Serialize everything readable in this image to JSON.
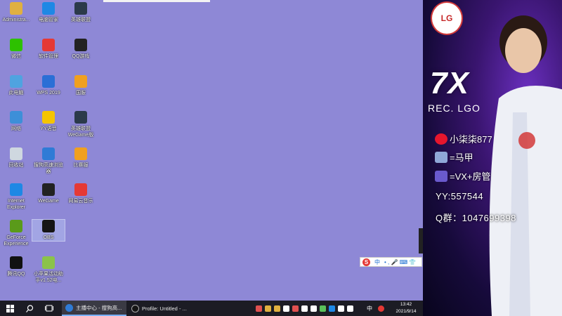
{
  "desktop": {
    "background_color": "#8e88d6",
    "icons": [
      {
        "label": "Administra...",
        "icon": "folder-user-icon",
        "color": "#e0b040"
      },
      {
        "label": "电脑管家",
        "icon": "shield-icon",
        "color": "#1e88e5"
      },
      {
        "label": "英雄联盟",
        "icon": "lol-icon",
        "color": "#2b3a4a"
      },
      {
        "label": "微信",
        "icon": "wechat-icon",
        "color": "#2dc100"
      },
      {
        "label": "软件管理",
        "icon": "apps-icon",
        "color": "#e53935"
      },
      {
        "label": "QQ游戏",
        "icon": "qq-game-icon",
        "color": "#222222"
      },
      {
        "label": "此电脑",
        "icon": "computer-icon",
        "color": "#4fa3e0"
      },
      {
        "label": "WPS 2019",
        "icon": "wps-icon",
        "color": "#2a6fd6"
      },
      {
        "label": "国服",
        "icon": "game-f-icon",
        "color": "#f0a020"
      },
      {
        "label": "网络",
        "icon": "network-icon",
        "color": "#3d8fd8"
      },
      {
        "label": "YY语音",
        "icon": "yy-icon",
        "color": "#f5c400"
      },
      {
        "label": "英雄联盟 WeGame版",
        "icon": "lol-icon",
        "color": "#2b3a4a"
      },
      {
        "label": "回收站",
        "icon": "recycle-bin-icon",
        "color": "#cfd8e0"
      },
      {
        "label": "搜狗高速浏览器",
        "icon": "sogou-browser-icon",
        "color": "#2f7bd6"
      },
      {
        "label": "比赛服",
        "icon": "game-f-icon",
        "color": "#f0a020"
      },
      {
        "label": "Internet Explorer",
        "icon": "ie-icon",
        "color": "#1e88e5"
      },
      {
        "label": "WeGame",
        "icon": "wegame-icon",
        "color": "#222222"
      },
      {
        "label": "网易云音乐",
        "icon": "netease-music-icon",
        "color": "#e53935"
      },
      {
        "label": "GeForce Experience",
        "icon": "nvidia-icon",
        "color": "#5a9a1a"
      },
      {
        "label": "OBS",
        "icon": "obs-icon",
        "color": "#151515",
        "selected": true
      },
      {
        "label": "腾讯QQ",
        "icon": "qq-icon",
        "color": "#111111"
      },
      {
        "label": "小苹果活动助手v1.52电...",
        "icon": "apple-helper-icon",
        "color": "#8bc34a"
      }
    ]
  },
  "taskbar": {
    "tasks": [
      {
        "label": "主播中心 - 搜狗高...",
        "icon": "sogou-browser-icon",
        "color": "#2f7bd6",
        "active": true
      },
      {
        "label": "Profile: Untitled - ...",
        "icon": "obs-icon",
        "color": "#151515",
        "active": false
      }
    ],
    "tray_lang": "中",
    "clock_time": "13:42",
    "clock_date": "2021/9/14",
    "tray_icons": [
      "#e05050",
      "#e0b040",
      "#e0b040",
      "#ffffff",
      "#e05050",
      "#ffffff",
      "#ffffff",
      "#5ac05a",
      "#1e88e5",
      "#ffffff",
      "#ffffff"
    ]
  },
  "ime_bar": {
    "lang": "中",
    "symbols": "• ,  🎤 ⌨ 👕"
  },
  "stream_overlay": {
    "big_number": "7X",
    "team_tag": "REC. LGO",
    "badge": "LG",
    "weibo": "小柒柒877",
    "row2": "=马甲",
    "row3": "=VX+房管",
    "yy": "YY:557544",
    "qq_group": "Q群：1047699398"
  }
}
